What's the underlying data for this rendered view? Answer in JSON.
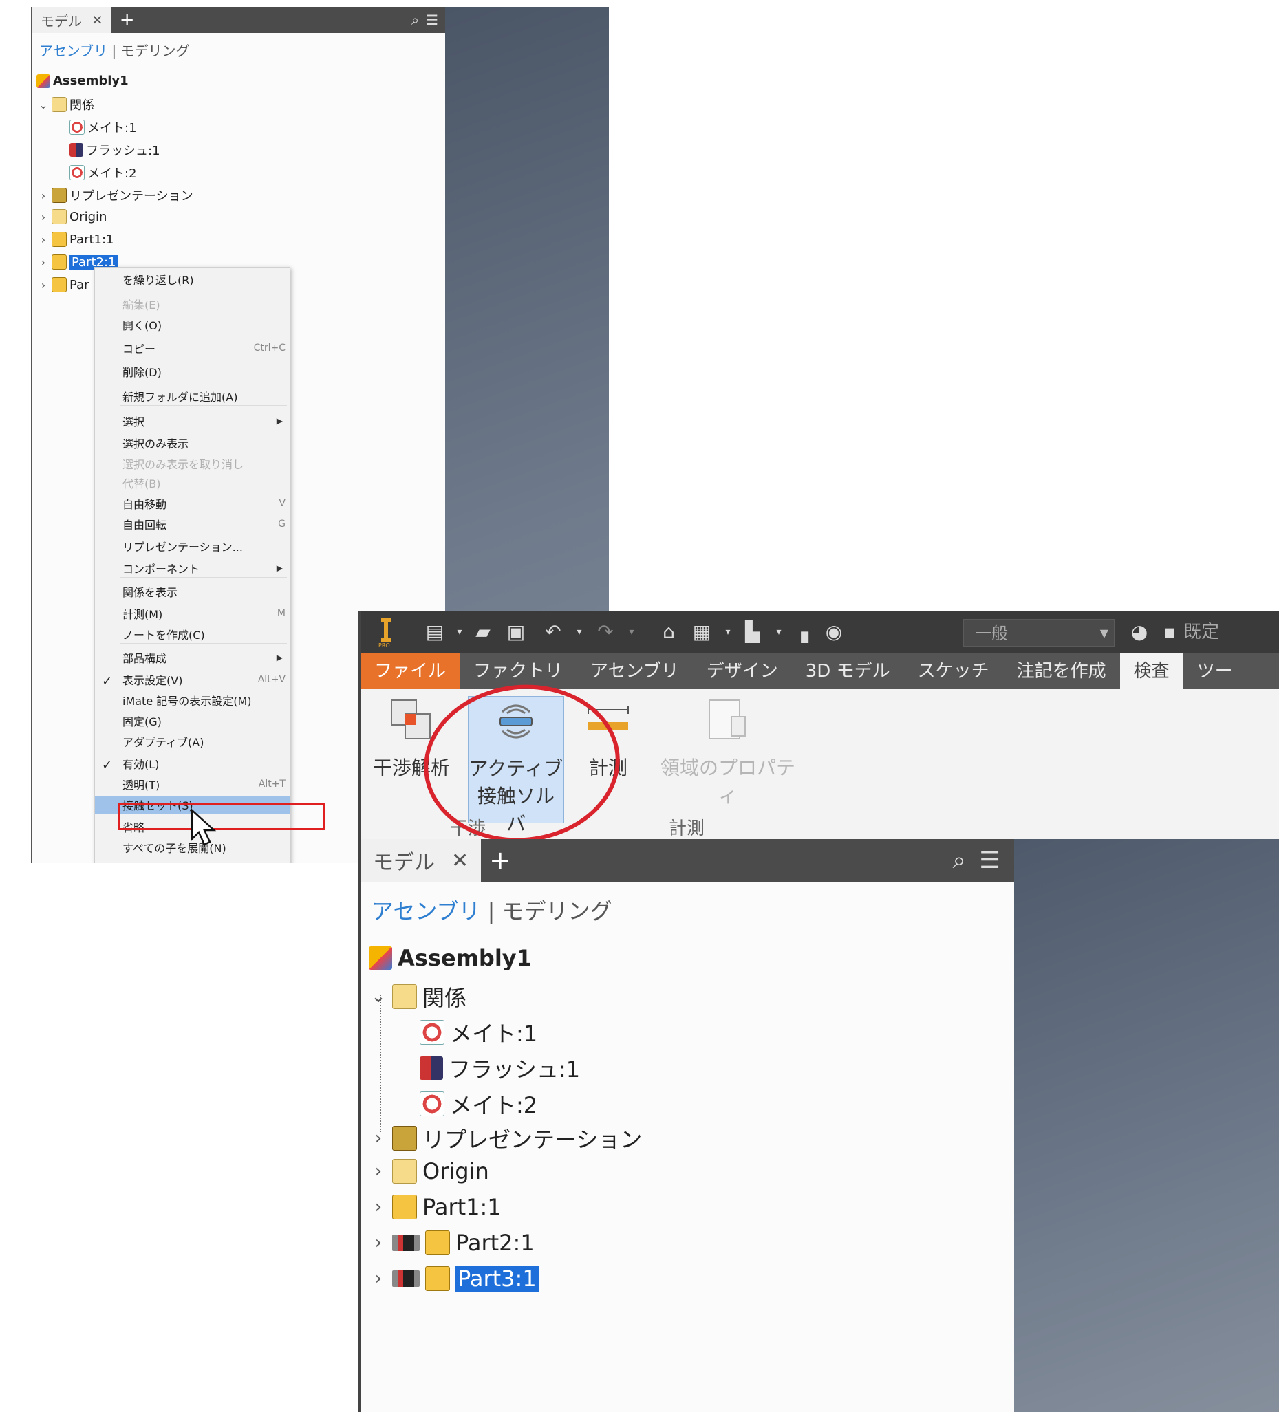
{
  "top_shot": {
    "browser_tab": "モデル",
    "add_tab": "+",
    "mode": {
      "active": "アセンブリ",
      "separator": "|",
      "other": "モデリング"
    },
    "tree": {
      "root": "Assembly1",
      "relations": "関係",
      "mate1": "メイト:1",
      "flush1": "フラッシュ:1",
      "mate2": "メイト:2",
      "representation": "リプレゼンテーション",
      "origin": "Origin",
      "part1": "Part1:1",
      "part2": "Part2:1",
      "part3": "Par"
    },
    "context_menu": [
      {
        "label": "を繰り返し(R)",
        "shortcut": ""
      },
      {
        "label": "編集(E)",
        "shortcut": ""
      },
      {
        "label": "開く(O)",
        "shortcut": ""
      },
      {
        "label": "コピー",
        "shortcut": "Ctrl+C"
      },
      {
        "label": "削除(D)",
        "shortcut": ""
      },
      {
        "label": "新規フォルダに追加(A)",
        "shortcut": ""
      },
      {
        "label": "選択",
        "shortcut": ""
      },
      {
        "label": "選択のみ表示",
        "shortcut": ""
      },
      {
        "label": "選択のみ表示を取り消し",
        "shortcut": ""
      },
      {
        "label": "代替(B)",
        "shortcut": ""
      },
      {
        "label": "自由移動",
        "shortcut": "V"
      },
      {
        "label": "自由回転",
        "shortcut": "G"
      },
      {
        "label": "リプレゼンテーション...",
        "shortcut": ""
      },
      {
        "label": "コンポーネント",
        "shortcut": ""
      },
      {
        "label": "関係を表示",
        "shortcut": ""
      },
      {
        "label": "計測(M)",
        "shortcut": "M"
      },
      {
        "label": "ノートを作成(C)",
        "shortcut": ""
      },
      {
        "label": "部品構成",
        "shortcut": ""
      },
      {
        "label": "表示設定(V)",
        "shortcut": "Alt+V"
      },
      {
        "label": "iMate 記号の表示設定(M)",
        "shortcut": ""
      },
      {
        "label": "固定(G)",
        "shortcut": ""
      },
      {
        "label": "アダプティブ(A)",
        "shortcut": ""
      },
      {
        "label": "有効(L)",
        "shortcut": ""
      },
      {
        "label": "透明(T)",
        "shortcut": "Alt+T"
      },
      {
        "label": "接触セット(S)",
        "shortcut": ""
      },
      {
        "label": "省略",
        "shortcut": ""
      },
      {
        "label": "すべての子を展開(N)",
        "shortcut": ""
      }
    ]
  },
  "bottom_shot": {
    "style_combo": "一般",
    "material_combo": "既定",
    "ribbon_tabs": [
      "ファイル",
      "ファクトリ",
      "アセンブリ",
      "デザイン",
      "3D モデル",
      "スケッチ",
      "注記を作成",
      "検査",
      "ツー"
    ],
    "ribbon_buttons": {
      "interference": "干渉解析",
      "contact_solver_line1": "アクティブ",
      "contact_solver_line2": "接触ソルバ",
      "measure": "計測",
      "region_props": "領域のプロパティ"
    },
    "groups": {
      "interference": "干渉",
      "measure": "計測"
    },
    "browser_tab": "モデル",
    "add_tab": "+",
    "mode": {
      "active": "アセンブリ",
      "separator": "|",
      "other": "モデリング"
    },
    "tree": {
      "root": "Assembly1",
      "relations": "関係",
      "mate1": "メイト:1",
      "flush1": "フラッシュ:1",
      "mate2": "メイト:2",
      "representation": "リプレゼンテーション",
      "origin": "Origin",
      "part1": "Part1:1",
      "part2": "Part2:1",
      "part3": "Part3:1"
    }
  },
  "colors": {
    "file_tab": "#e8722a",
    "selection": "#1e6fd9",
    "annotation_red": "#e02020"
  }
}
